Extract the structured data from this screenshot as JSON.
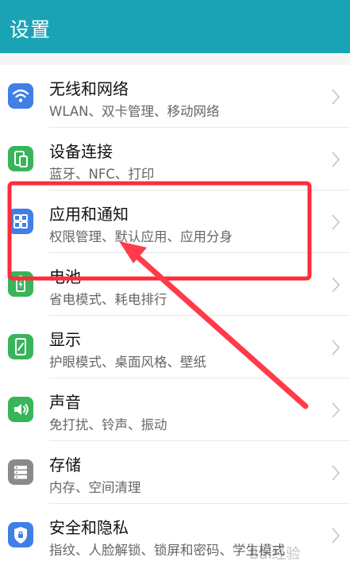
{
  "header": {
    "title": "设置"
  },
  "colors": {
    "appbar": "#1aa3b5",
    "annotation": "#ff2b3a"
  },
  "items": [
    {
      "label": "无线和网络",
      "sub": "WLAN、双卡管理、移动网络",
      "icon": "wifi-icon",
      "icon_color": "#3f7fe6"
    },
    {
      "label": "设备连接",
      "sub": "蓝牙、NFC、打印",
      "icon": "device-connection-icon",
      "icon_color": "#38b45a"
    },
    {
      "label": "应用和通知",
      "sub": "权限管理、默认应用、应用分身",
      "icon": "apps-grid-icon",
      "icon_color": "#3f7fe6"
    },
    {
      "label": "电池",
      "sub": "省电模式、耗电排行",
      "icon": "battery-icon",
      "icon_color": "#38b45a"
    },
    {
      "label": "显示",
      "sub": "护眼模式、桌面风格、壁纸",
      "icon": "display-icon",
      "icon_color": "#38b45a"
    },
    {
      "label": "声音",
      "sub": "免打扰、铃声、振动",
      "icon": "sound-icon",
      "icon_color": "#38b45a"
    },
    {
      "label": "存储",
      "sub": "内存、空间清理",
      "icon": "storage-icon",
      "icon_color": "#8a8a8a"
    },
    {
      "label": "安全和隐私",
      "sub": "指纹、人脸解锁、锁屏和密码、学生模式",
      "icon": "security-shield-icon",
      "icon_color": "#3f7fe6"
    }
  ],
  "watermark": {
    "text": "Bai经验"
  }
}
